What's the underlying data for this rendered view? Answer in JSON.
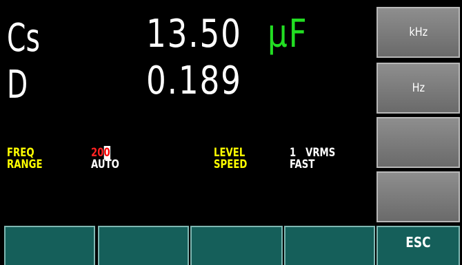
{
  "measurement": {
    "primary_label": "Cs",
    "primary_value": "13.50",
    "primary_unit": "µF",
    "secondary_label": "D",
    "secondary_value": "0.189"
  },
  "params": {
    "freq_label": "FREQ",
    "freq_value_edit": "20",
    "freq_value_cursor": "0",
    "range_label": "RANGE",
    "range_value": "AUTO",
    "level_label": "LEVEL",
    "level_value": "1   VRMS",
    "speed_label": "SPEED",
    "speed_value": "FAST"
  },
  "side_keys": {
    "key1": "kHz",
    "key2": "Hz",
    "key3": "",
    "key4": ""
  },
  "bottom_keys": {
    "key1": "",
    "key2": "",
    "key3": "",
    "key4": "",
    "esc": "ESC"
  },
  "colors": {
    "background": "#000000",
    "label_yellow": "#ffff00",
    "unit_green": "#22dd22",
    "edit_red": "#ff2222",
    "softkey_gray": "#7c7c7c",
    "bottom_key_teal": "#155f5a"
  }
}
